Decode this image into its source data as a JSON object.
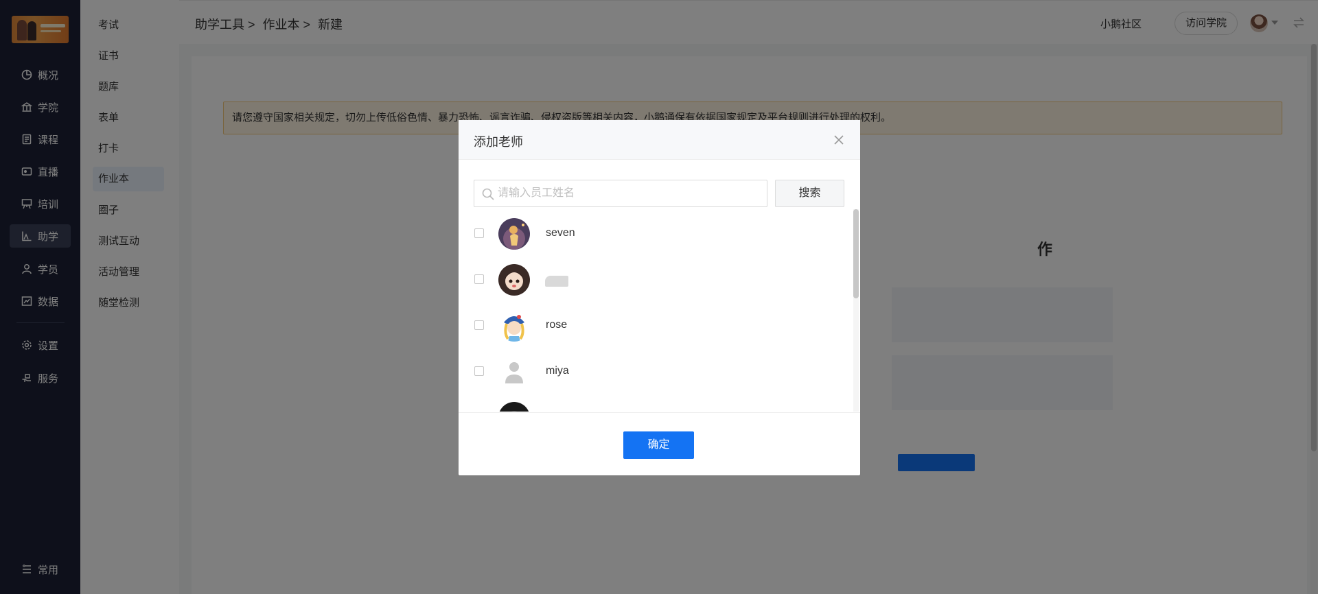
{
  "nav": {
    "items": [
      {
        "label": "概况",
        "icon": "pie-chart-icon"
      },
      {
        "label": "学院",
        "icon": "academy-icon"
      },
      {
        "label": "课程",
        "icon": "book-icon"
      },
      {
        "label": "直播",
        "icon": "live-icon"
      },
      {
        "label": "培训",
        "icon": "training-icon"
      },
      {
        "label": "助学",
        "icon": "assist-chart-icon"
      },
      {
        "label": "学员",
        "icon": "user-icon"
      },
      {
        "label": "数据",
        "icon": "data-icon"
      },
      {
        "label": "设置",
        "icon": "gear-icon"
      },
      {
        "label": "服务",
        "icon": "service-icon"
      }
    ],
    "bottom": {
      "label": "常用",
      "icon": "list-icon"
    }
  },
  "subnav": {
    "items": [
      "考试",
      "证书",
      "题库",
      "表单",
      "打卡",
      "作业本",
      "圈子",
      "测试互动",
      "活动管理",
      "随堂检测"
    ]
  },
  "header": {
    "breadcrumb": [
      "助学工具 >",
      "作业本 >",
      "新建"
    ],
    "community": "小鹅社区",
    "visit": "访问学院"
  },
  "notice": "请您遵守国家相关规定，切勿上传低俗色情、暴力恐怖、谣言诈骗、侵权盗版等相关内容，小鹅通保有依据国家规定及平台规则进行处理的权利。",
  "background": {
    "heading_fragment": "作"
  },
  "modal": {
    "title": "添加老师",
    "search_placeholder": "请输入员工姓名",
    "search_button": "搜索",
    "teachers": [
      {
        "name": "seven"
      },
      {
        "name": ""
      },
      {
        "name": "rose"
      },
      {
        "name": "miya"
      }
    ],
    "confirm": "确定"
  },
  "colors": {
    "sidebar": "#1c2136",
    "primary": "#1473f3",
    "notice_bg": "#fff4e3"
  }
}
